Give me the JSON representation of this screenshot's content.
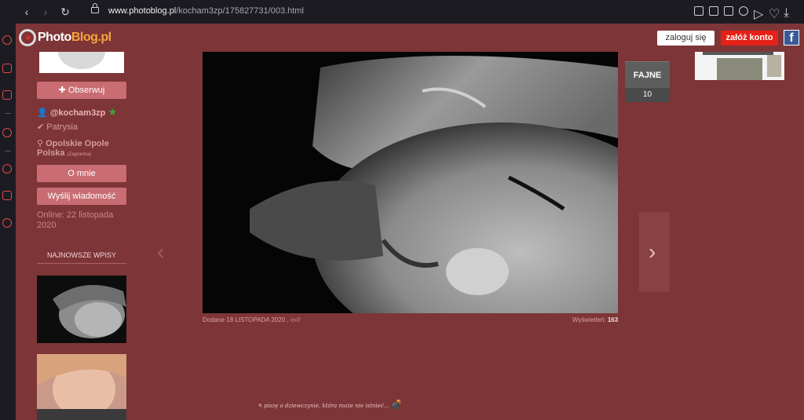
{
  "browser": {
    "url_host": "www.photoblog.pl",
    "url_path": "/kocham3zp/175827731/003.html"
  },
  "header": {
    "logo_photo": "Photo",
    "logo_blog": "Blog.pl",
    "login_label": "zaloguj się",
    "signup_label": "załóż konto",
    "fb_label": "f"
  },
  "profile": {
    "follow_label": "Obserwuj",
    "username": "@kocham3zp",
    "name": "Patrysia",
    "location_main": "Opolskie Opole",
    "location_country": "Polska",
    "location_note": "(Zagranica)",
    "about_label": "O mnie",
    "message_label": "Wyślij wiadomość",
    "online": "Online: 22 listopada 2020"
  },
  "sidebar": {
    "newest_title": "NAJNOWSZE WPISY"
  },
  "post": {
    "like_label": "FAJNE",
    "like_count": "10",
    "added_prefix": "Dodane",
    "added_date": "18 LISTOPADA 2020",
    "exif_label": "exif",
    "views_label": "Wyświetleń:",
    "views_count": "163",
    "description": "piszę o dziewczynie, która może nie istnieć..."
  },
  "colors": {
    "background": "#7e3537",
    "accent": "#e62117",
    "button": "#c96d72"
  }
}
